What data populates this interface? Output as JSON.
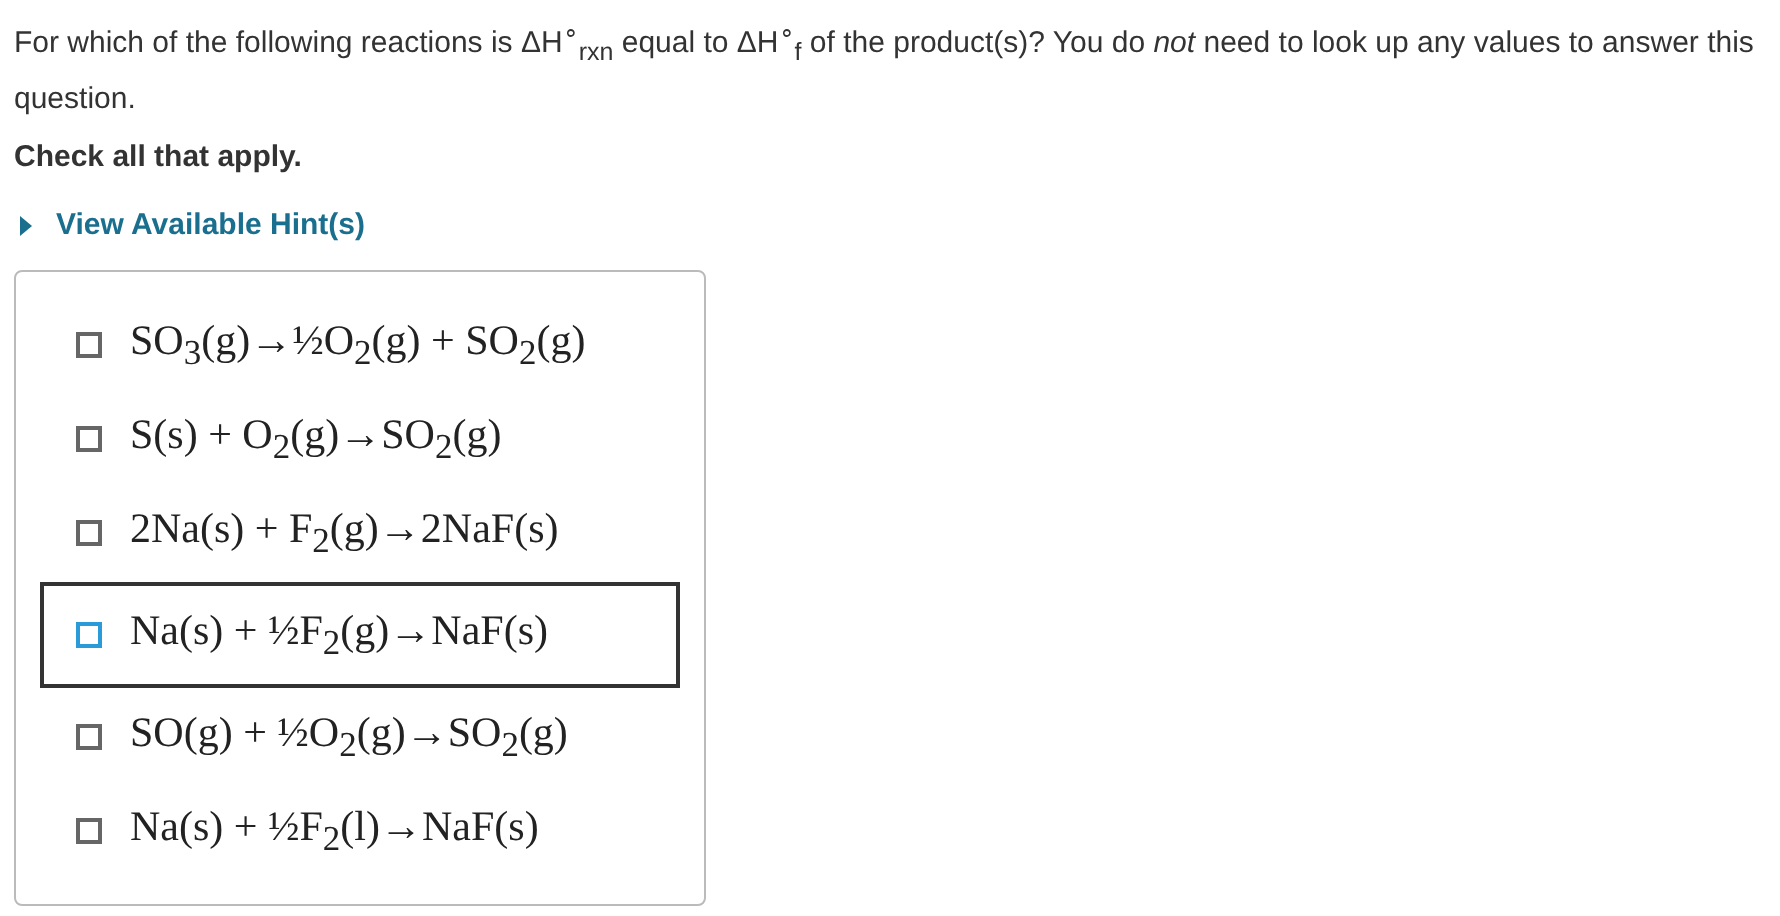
{
  "question": "For which of the following reactions is ΔH$^{∘}$$_{rxn}$ equal to ΔH$^{∘}$$_{f}$ of the product(s)? You do *not* need to look up any values to answer this question.",
  "instruction": "Check all that apply.",
  "hint": {
    "label": "View Available Hint(s)",
    "expanded": false
  },
  "options": [
    {
      "text": "SO$_{3}$(g)→½O$_{2}$(g) + SO$_{2}$(g)",
      "checked": false,
      "focused": false
    },
    {
      "text": "S(s) + O$_{2}$(g)→SO$_{2}$(g)",
      "checked": false,
      "focused": false
    },
    {
      "text": "2Na(s) + F$_{2}$(g)→2NaF(s)",
      "checked": false,
      "focused": false
    },
    {
      "text": "Na(s) + ½F$_{2}$(g)→NaF(s)",
      "checked": false,
      "focused": true
    },
    {
      "text": "SO(g) + ½O$_{2}$(g)→SO$_{2}$(g)",
      "checked": false,
      "focused": false
    },
    {
      "text": "Na(s) + ½F$_{2}$(l)→NaF(s)",
      "checked": false,
      "focused": false
    }
  ]
}
